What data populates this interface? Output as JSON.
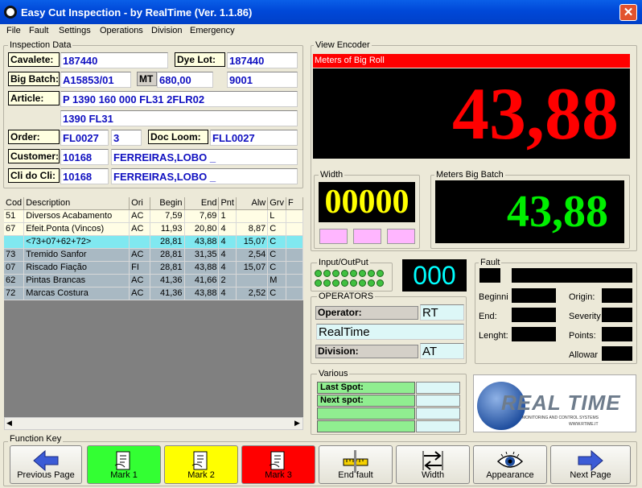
{
  "window": {
    "title": "Easy Cut Inspection - by RealTime   (Ver. 1.1.86)",
    "close": "✕"
  },
  "menu": [
    "File",
    "Fault",
    "Settings",
    "Operations",
    "Division",
    "Emergency"
  ],
  "inspection": {
    "title": "Inspection Data",
    "cavalete_label": "Cavalete:",
    "cavalete": "187440",
    "dye_lot_label": "Dye Lot:",
    "dye_lot": "187440",
    "big_batch_label": "Big Batch:",
    "big_batch": "A15853/01",
    "mt_label": "MT",
    "mt": "680,00",
    "mt_extra": "9001",
    "article_label": "Article:",
    "article1": "P 1390 160 000 FL31 2FLR02",
    "article2": "1390 FL31",
    "order_label": "Order:",
    "order": "FL0027",
    "order_seq": "3",
    "doc_loom_label": "Doc Loom:",
    "doc_loom": "FLL0027",
    "customer_label": "Customer:",
    "customer_code": "10168",
    "customer_name": "FERREIRAS,LOBO _",
    "clicli_label": "Cli do Cli:",
    "clicli_code": "10168",
    "clicli_name": "FERREIRAS,LOBO _"
  },
  "grid": {
    "columns": [
      "Cod",
      "Description",
      "Ori",
      "Begin",
      "End",
      "Pnt",
      "Alw",
      "Grv",
      "F"
    ],
    "rows": [
      {
        "style": "cream",
        "cells": [
          "51",
          "Diversos Acabamento",
          "AC",
          "7,59",
          "7,69",
          "1",
          "",
          "L",
          ""
        ]
      },
      {
        "style": "cream",
        "cells": [
          "67",
          "Efeit.Ponta (Vincos)",
          "AC",
          "11,93",
          "20,80",
          "4",
          "8,87",
          "C",
          ""
        ]
      },
      {
        "style": "cyan",
        "cells": [
          "",
          "<73+07+62+72>",
          "",
          "28,81",
          "43,88",
          "4",
          "15,07",
          "C",
          ""
        ]
      },
      {
        "style": "gray",
        "cells": [
          "73",
          "Tremido Sanfor",
          "AC",
          "28,81",
          "31,35",
          "4",
          "2,54",
          "C",
          ""
        ]
      },
      {
        "style": "gray",
        "cells": [
          "07",
          "Riscado Fiação",
          "FI",
          "28,81",
          "43,88",
          "4",
          "15,07",
          "C",
          ""
        ]
      },
      {
        "style": "gray",
        "cells": [
          "62",
          "Pintas Brancas",
          "AC",
          "41,36",
          "41,66",
          "2",
          "",
          "M",
          ""
        ]
      },
      {
        "style": "gray",
        "cells": [
          "72",
          "Marcas Costura",
          "AC",
          "41,36",
          "43,88",
          "4",
          "2,52",
          "C",
          ""
        ]
      }
    ]
  },
  "encoder": {
    "title": "View Encoder",
    "bar_label": "Meters of Big Roll",
    "value": "43,88"
  },
  "width": {
    "title": "Width",
    "value": "00000"
  },
  "big_batch_meters": {
    "title": "Meters Big Batch",
    "value": "43,88"
  },
  "io": {
    "title": "Input/OutPut",
    "counter": "000"
  },
  "operators": {
    "title": "OPERATORS",
    "operator_label": "Operator:",
    "operator": "RT",
    "name": "RealTime",
    "division_label": "Division:",
    "division": "AT"
  },
  "fault": {
    "title": "Fault",
    "begin": "Beginni",
    "end": "End:",
    "length": "Lenght:",
    "origin": "Origin:",
    "severity": "Severity",
    "points": "Points:",
    "allowance": "Allowar"
  },
  "various": {
    "title": "Various",
    "last_spot": "Last Spot:",
    "next_spot": "Next spot:"
  },
  "logo": {
    "name": "REAL TIME",
    "tagline": "MONITORING AND CONTROL SYSTEMS",
    "url": "WWW.RTIME.IT"
  },
  "function_keys": {
    "title": "Function Key",
    "buttons": [
      "Previous Page",
      "Mark 1",
      "Mark 2",
      "Mark 3",
      "End fault",
      "Width",
      "Appearance",
      "Next Page"
    ]
  },
  "colors": {
    "mark1": "#33FF33",
    "mark2": "#FFFF00",
    "mark3": "#FF0000",
    "encoder_digits": "#FF0000",
    "batch_digits": "#00EE00",
    "width_digits": "#FFFF00",
    "io_digits": "#00FFFF"
  }
}
